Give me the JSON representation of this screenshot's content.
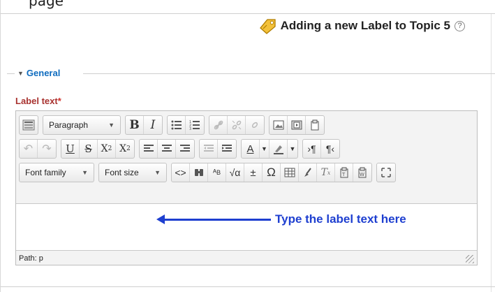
{
  "top_cut_text": "page",
  "header": {
    "title": "Adding a new Label to Topic 5",
    "help": "?"
  },
  "section": {
    "legend": "General"
  },
  "field": {
    "label": "Label text",
    "required_mark": "*"
  },
  "toolbar": {
    "paragraph_select": "Paragraph",
    "font_family_select": "Font family",
    "font_size_select": "Font size",
    "row1": [
      "toolbar-toggle",
      "B",
      "I",
      "bullet-list",
      "numbered-list",
      "link",
      "unlink",
      "anchor",
      "image",
      "media",
      "paste"
    ],
    "row2": [
      "undo",
      "redo",
      "U",
      "S",
      "X2",
      "X²",
      "align-left",
      "align-center",
      "align-right",
      "outdent",
      "indent",
      "A",
      "highlight",
      "ltr",
      "rtl"
    ]
  },
  "editor": {
    "annotation": "Type the label text here"
  },
  "status": {
    "path": "Path: p"
  }
}
